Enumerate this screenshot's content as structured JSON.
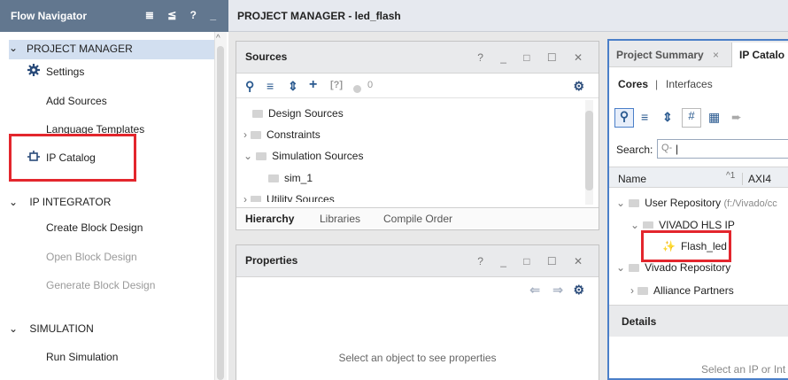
{
  "flow_nav": {
    "title": "Flow Navigator",
    "tools": "≣ ≦ ? _",
    "sections": [
      {
        "label": "PROJECT MANAGER",
        "items": [
          "Settings",
          "Add Sources",
          "Language Templates",
          "IP Catalog"
        ]
      },
      {
        "label": "IP INTEGRATOR",
        "items": [
          "Create Block Design",
          "Open Block Design",
          "Generate Block Design"
        ]
      },
      {
        "label": "SIMULATION",
        "items": [
          "Run Simulation"
        ]
      }
    ]
  },
  "pm": {
    "title": "PROJECT MANAGER - led_flash"
  },
  "sources": {
    "title": "Sources",
    "win": "? _ □ ☐ ✕",
    "badge": "0",
    "tree": [
      "Design Sources",
      "Constraints",
      "Simulation Sources",
      "sim_1",
      "Utility Sources"
    ],
    "tabs": [
      "Hierarchy",
      "Libraries",
      "Compile Order"
    ]
  },
  "properties": {
    "title": "Properties",
    "win": "? _ □ ☐ ✕",
    "placeholder": "Select an object to see properties"
  },
  "right": {
    "tabs": [
      "Project Summary",
      "IP Catalo"
    ],
    "links": [
      "Cores",
      "Interfaces"
    ],
    "search_label": "Search:",
    "col_name": "Name",
    "col_sort": "^1",
    "col_axi": "AXI4",
    "tree": [
      "User Repository",
      "(f:/Vivado/cc",
      "VIVADO HLS IP",
      "Flash_led",
      "Vivado Repository",
      "Alliance Partners"
    ],
    "details": "Details",
    "footer": "Select an IP or Int"
  }
}
